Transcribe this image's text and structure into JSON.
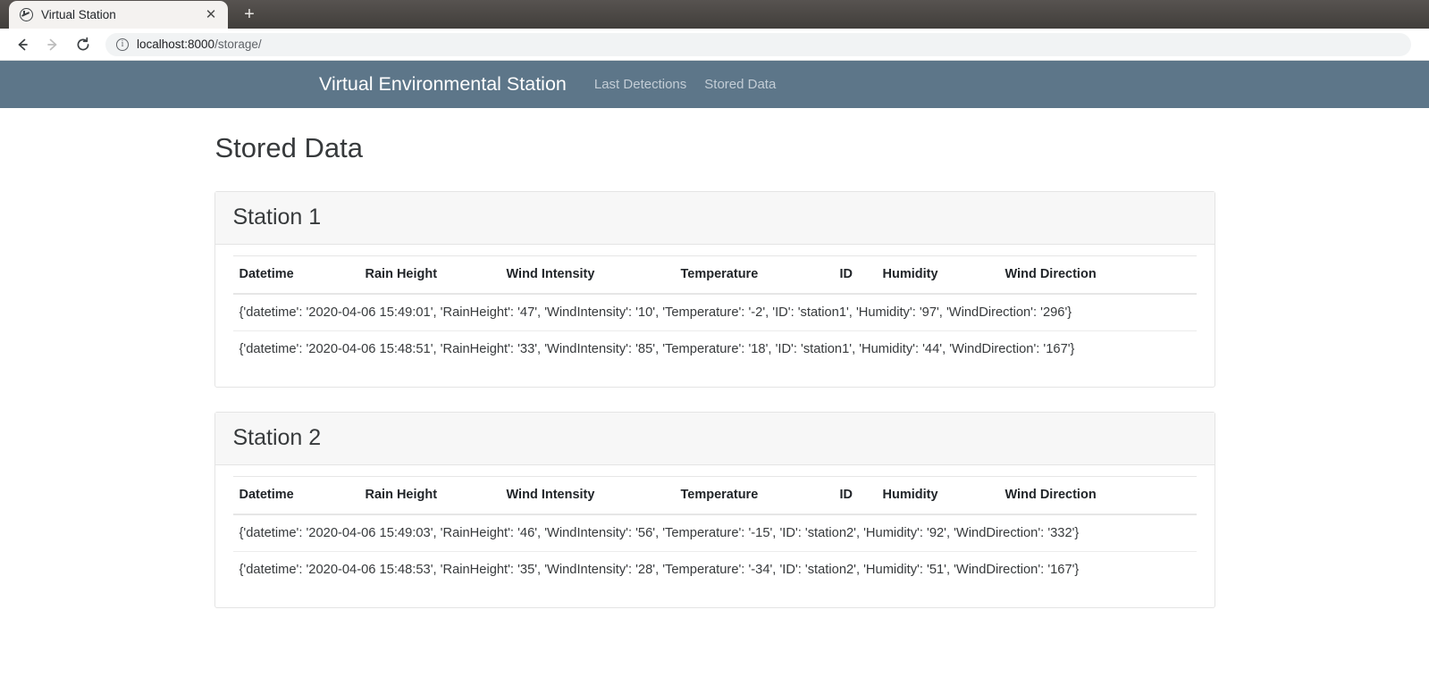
{
  "browser": {
    "tab": {
      "title": "Virtual Station",
      "favicon_icon": "globe-icon",
      "close_icon": "close-icon"
    },
    "new_tab_label": "+",
    "back_icon": "back-arrow-icon",
    "forward_icon": "forward-arrow-icon",
    "reload_icon": "reload-icon",
    "omnibox": {
      "info_icon": "info-circle-icon",
      "info_glyph": "i",
      "host": "localhost:8000",
      "path": "/storage/"
    }
  },
  "navbar": {
    "brand": "Virtual Environmental Station",
    "links": [
      {
        "label": "Last Detections"
      },
      {
        "label": "Stored Data"
      }
    ]
  },
  "page": {
    "title": "Stored Data",
    "table_headers": [
      "Datetime",
      "Rain Height",
      "Wind Intensity",
      "Temperature",
      "ID",
      "Humidity",
      "Wind Direction"
    ],
    "stations": [
      {
        "title": "Station 1",
        "rows": [
          "{'datetime': '2020-04-06 15:49:01', 'RainHeight': '47', 'WindIntensity': '10', 'Temperature': '-2', 'ID': 'station1', 'Humidity': '97', 'WindDirection': '296'}",
          "{'datetime': '2020-04-06 15:48:51', 'RainHeight': '33', 'WindIntensity': '85', 'Temperature': '18', 'ID': 'station1', 'Humidity': '44', 'WindDirection': '167'}"
        ]
      },
      {
        "title": "Station 2",
        "rows": [
          "{'datetime': '2020-04-06 15:49:03', 'RainHeight': '46', 'WindIntensity': '56', 'Temperature': '-15', 'ID': 'station2', 'Humidity': '92', 'WindDirection': '332'}",
          "{'datetime': '2020-04-06 15:48:53', 'RainHeight': '35', 'WindIntensity': '28', 'Temperature': '-34', 'ID': 'station2', 'Humidity': '51', 'WindDirection': '167'}"
        ]
      }
    ]
  },
  "colors": {
    "navbar_bg": "#5d7689",
    "brand_text": "#ffffff",
    "navlink_text": "#c3cdd6",
    "card_header_bg": "#f7f7f7",
    "body_text": "#373a3c"
  }
}
